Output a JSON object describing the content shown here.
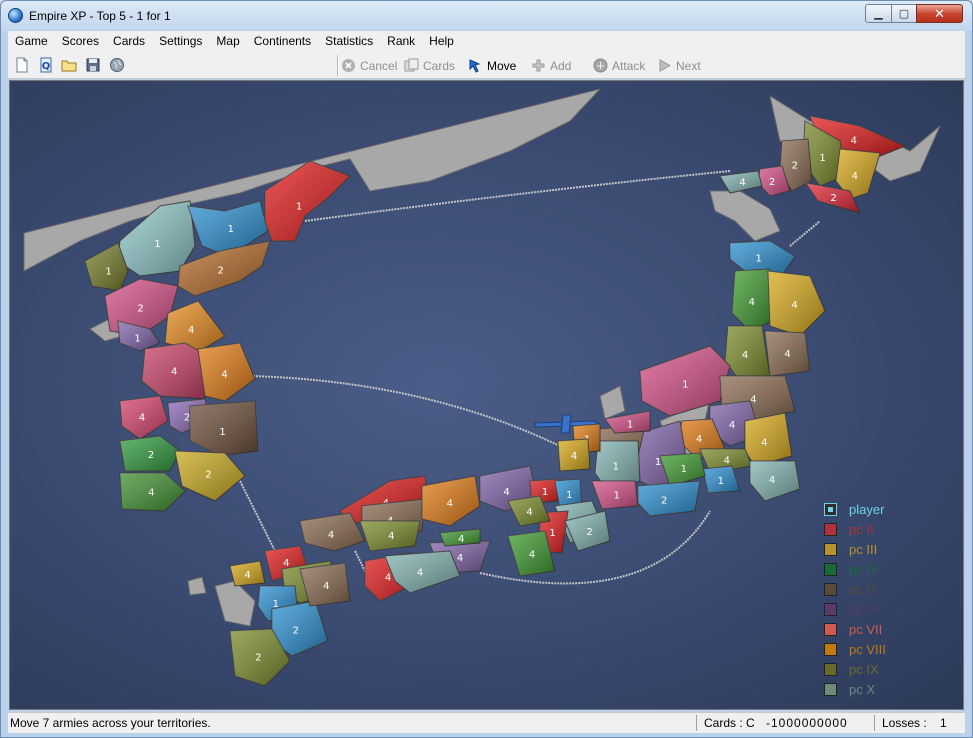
{
  "window": {
    "title": "Empire XP - Top 5 - 1 for 1",
    "close_glyph": "✕",
    "min_glyph": "▁",
    "max_glyph": "▢"
  },
  "menu": [
    "Game",
    "Scores",
    "Cards",
    "Settings",
    "Map",
    "Continents",
    "Statistics",
    "Rank",
    "Help"
  ],
  "toolbar": {
    "file_icons": [
      "new-file-icon",
      "open-help-icon",
      "open-folder-icon",
      "save-disk-icon",
      "globe-icon"
    ],
    "actions": [
      {
        "label": "Cancel",
        "icon": "cancel-icon",
        "enabled": false
      },
      {
        "label": "Cards",
        "icon": "cards-icon",
        "enabled": false
      },
      {
        "label": "Move",
        "icon": "move-icon",
        "enabled": true
      },
      {
        "label": "Add",
        "icon": "add-icon",
        "enabled": false
      },
      {
        "label": "Attack",
        "icon": "attack-icon",
        "enabled": false
      },
      {
        "label": "Next",
        "icon": "next-icon",
        "enabled": false
      }
    ]
  },
  "map": {
    "name_icon": "japan-korea-map",
    "territories": [
      {
        "id": "kor-n1",
        "army": "1",
        "color": "#8ec7c9"
      },
      {
        "id": "kor-n2",
        "army": "1",
        "color": "#2a8fd0"
      },
      {
        "id": "kor-n3",
        "army": "1",
        "color": "#e21b1b"
      },
      {
        "id": "kor-n4",
        "army": "1",
        "color": "#757d2a"
      },
      {
        "id": "kor-n5",
        "army": "2",
        "color": "#b46a2a"
      },
      {
        "id": "kor-n6",
        "army": "2",
        "color": "#d44f86"
      },
      {
        "id": "kor-n7",
        "army": "1",
        "color": "#7e62a8"
      },
      {
        "id": "kor-n8",
        "army": "4",
        "color": "#e78a1e"
      },
      {
        "id": "kor-c1",
        "army": "4",
        "color": "#c84067"
      },
      {
        "id": "kor-c2",
        "army": "4",
        "color": "#e07a14"
      },
      {
        "id": "kor-s1",
        "army": "4",
        "color": "#d6416c"
      },
      {
        "id": "kor-s2",
        "army": "2",
        "color": "#8b68b5"
      },
      {
        "id": "kor-s3",
        "army": "1",
        "color": "#6d4e3a"
      },
      {
        "id": "kor-s4",
        "army": "2",
        "color": "#2f9a3d"
      },
      {
        "id": "kor-s5",
        "army": "2",
        "color": "#c7a81d"
      },
      {
        "id": "kor-s6",
        "army": "4",
        "color": "#3e8f2f"
      },
      {
        "id": "hok-1",
        "army": "4",
        "color": "#e21b1b"
      },
      {
        "id": "hok-2",
        "army": "1",
        "color": "#7a8a2a"
      },
      {
        "id": "hok-3",
        "army": "2",
        "color": "#8a6a50"
      },
      {
        "id": "hok-4",
        "army": "4",
        "color": "#d6a81a"
      },
      {
        "id": "hok-5",
        "army": "2",
        "color": "#e02535"
      },
      {
        "id": "hok-6",
        "army": "2",
        "color": "#d44f86"
      },
      {
        "id": "hok-7",
        "army": "4",
        "color": "#7fb2b0"
      },
      {
        "id": "toh-1",
        "army": "1",
        "color": "#2a8fd0"
      },
      {
        "id": "toh-2",
        "army": "4",
        "color": "#3e9a2f"
      },
      {
        "id": "toh-3",
        "army": "4",
        "color": "#d6a81a"
      },
      {
        "id": "toh-4",
        "army": "4",
        "color": "#7a8a2a"
      },
      {
        "id": "toh-5",
        "army": "4",
        "color": "#8a6a50"
      },
      {
        "id": "toh-6",
        "army": "1",
        "color": "#d44f86"
      },
      {
        "id": "toh-7",
        "army": "4",
        "color": "#8a6a50"
      },
      {
        "id": "kan-1",
        "army": "4",
        "color": "#7e62a8"
      },
      {
        "id": "kan-2",
        "army": "4",
        "color": "#e07a14"
      },
      {
        "id": "kan-3",
        "army": "4",
        "color": "#d6a81a"
      },
      {
        "id": "kan-4",
        "army": "4",
        "color": "#7a8a2a"
      },
      {
        "id": "kan-5",
        "army": "1",
        "color": "#2a8fd0"
      },
      {
        "id": "kan-6",
        "army": "4",
        "color": "#7fb2b0"
      },
      {
        "id": "chu-1",
        "army": "1",
        "color": "#7e62a8"
      },
      {
        "id": "chu-2",
        "army": "1",
        "color": "#8a6a50"
      },
      {
        "id": "chu-3",
        "army": "1",
        "color": "#7fb2b0"
      },
      {
        "id": "chu-4",
        "army": "1",
        "color": "#d44f86"
      },
      {
        "id": "chu-5",
        "army": "1",
        "color": "#3e9a2f"
      },
      {
        "id": "chu-6",
        "army": "2",
        "color": "#2a8fd0"
      },
      {
        "id": "chu-7",
        "army": "1",
        "color": "#e07a14"
      },
      {
        "id": "chu-8",
        "army": "4",
        "color": "#d6a81a"
      },
      {
        "id": "chu-9",
        "army": "1",
        "color": "#d44f86"
      },
      {
        "id": "kin-1",
        "army": "4",
        "color": "#e21b1b"
      },
      {
        "id": "kin-2",
        "army": "4",
        "color": "#8a6a50"
      },
      {
        "id": "kin-3",
        "army": "4",
        "color": "#e07a14"
      },
      {
        "id": "kin-4",
        "army": "4",
        "color": "#7e62a8"
      },
      {
        "id": "kin-5",
        "army": "1",
        "color": "#e21b1b"
      },
      {
        "id": "kin-6",
        "army": "1",
        "color": "#2a8fd0"
      },
      {
        "id": "kin-7",
        "army": "4",
        "color": "#7fb2b0"
      },
      {
        "id": "kin-8",
        "army": "1",
        "color": "#e21b1b"
      },
      {
        "id": "kin-9",
        "army": "2",
        "color": "#7fb2b0"
      },
      {
        "id": "kin-10",
        "army": "4",
        "color": "#3e9a2f"
      },
      {
        "id": "kin-11",
        "army": "4",
        "color": "#7a8a2a"
      },
      {
        "id": "cgk-1",
        "army": "4",
        "color": "#8a6a50"
      },
      {
        "id": "cgk-2",
        "army": "4",
        "color": "#7a8a2a"
      },
      {
        "id": "cgk-3",
        "army": "4",
        "color": "#7e62a8"
      },
      {
        "id": "cgk-4",
        "army": "4",
        "color": "#3e9a2f"
      },
      {
        "id": "shi-1",
        "army": "4",
        "color": "#e21b1b"
      },
      {
        "id": "shi-2",
        "army": "4",
        "color": "#7fb2b0"
      },
      {
        "id": "kyu-1",
        "army": "4",
        "color": "#d6a81a"
      },
      {
        "id": "kyu-2",
        "army": "4",
        "color": "#e21b1b"
      },
      {
        "id": "kyu-3",
        "army": "4",
        "color": "#7a8a2a"
      },
      {
        "id": "kyu-4",
        "army": "1",
        "color": "#2a8fd0"
      },
      {
        "id": "kyu-5",
        "army": "2",
        "color": "#2a8fd0"
      },
      {
        "id": "kyu-6",
        "army": "4",
        "color": "#8a6a50"
      },
      {
        "id": "kyu-7",
        "army": "2",
        "color": "#7a8a2a"
      }
    ]
  },
  "legend": [
    {
      "label": "player",
      "color": "#6fd3e8",
      "swatch": "#2e2e2e"
    },
    {
      "label": "pc II",
      "color": "#b2303a",
      "swatch": "#b2303a"
    },
    {
      "label": "pc III",
      "color": "#b8922e",
      "swatch": "#b8922e"
    },
    {
      "label": "pc IV",
      "color": "#1a6a3a",
      "swatch": "#1a6a3a"
    },
    {
      "label": "pc V",
      "color": "#5a4a3a",
      "swatch": "#5a4a3a"
    },
    {
      "label": "pc VI",
      "color": "#5a3a6a",
      "swatch": "#5a3a6a"
    },
    {
      "label": "pc VII",
      "color": "#d05a50",
      "swatch": "#d05a50"
    },
    {
      "label": "pc VIII",
      "color": "#c07a10",
      "swatch": "#c07a10"
    },
    {
      "label": "pc IX",
      "color": "#6a6a28",
      "swatch": "#6a6a28"
    },
    {
      "label": "pc X",
      "color": "#6a8a7a",
      "swatch": "#6a8a7a"
    }
  ],
  "status": {
    "message": "Move 7 armies across your territories.",
    "cards": "Cards : C",
    "score": "-1000000000",
    "losses_label": "Losses :",
    "losses": "1"
  }
}
